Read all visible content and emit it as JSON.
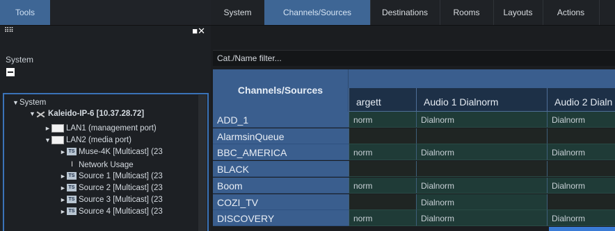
{
  "left": {
    "tools_tab": "Tools",
    "panel_title": "System",
    "tree": [
      {
        "label": "System",
        "arrow": "▼",
        "icon": "none",
        "bold": false
      },
      {
        "label": "Kaleido-IP-6 [10.37.28.72]",
        "arrow": "▼",
        "icon": "device-icon",
        "bold": true
      },
      {
        "label": "LAN1 (management port)",
        "arrow": "►",
        "icon": "port-icon",
        "bold": false
      },
      {
        "label": "LAN2 (media port)",
        "arrow": "▼",
        "icon": "port-icon",
        "bold": false
      },
      {
        "label": "Muse-4K [Multicast] (23",
        "arrow": "►",
        "icon": "ts-icon",
        "bold": false
      },
      {
        "label": "Network Usage",
        "arrow": "",
        "icon": "usage-icon",
        "bold": false
      },
      {
        "label": "Source 1 [Multicast] (23",
        "arrow": "►",
        "icon": "ts-icon",
        "bold": false
      },
      {
        "label": "Source 2 [Multicast] (23",
        "arrow": "►",
        "icon": "ts-icon",
        "bold": false
      },
      {
        "label": "Source 3 [Multicast] (23",
        "arrow": "►",
        "icon": "ts-icon",
        "bold": false
      },
      {
        "label": "Source 4 [Multicast] (23",
        "arrow": "►",
        "icon": "ts-icon",
        "bold": false
      }
    ]
  },
  "tabs": [
    "System",
    "Channels/Sources",
    "Destinations",
    "Rooms",
    "Layouts",
    "Actions"
  ],
  "active_tab": "Channels/Sources",
  "filter_placeholder": "Cat./Name filter...",
  "grid": {
    "row_header_title": "Channels/Sources",
    "columns": [
      "argett",
      "Audio 1 Dialnorm",
      "Audio 2 Dialn"
    ],
    "rows": [
      {
        "name": "ADD_1",
        "cells": [
          "norm",
          "Dialnorm",
          "Dialnorm"
        ]
      },
      {
        "name": "AlarmsinQueue",
        "cells": [
          "",
          "",
          ""
        ]
      },
      {
        "name": "BBC_AMERICA",
        "cells": [
          "norm",
          "Dialnorm",
          "Dialnorm"
        ]
      },
      {
        "name": "BLACK",
        "cells": [
          "",
          "",
          ""
        ]
      },
      {
        "name": "Boom",
        "cells": [
          "norm",
          "Dialnorm",
          "Dialnorm"
        ]
      },
      {
        "name": "COZI_TV",
        "cells": [
          "",
          "Dialnorm",
          ""
        ]
      },
      {
        "name": "DISCOVERY",
        "cells": [
          "norm",
          "Dialnorm",
          "Dialnorm"
        ]
      }
    ]
  },
  "colors": {
    "accent": "#3e6695",
    "row_label_bg": "#3a5e8e",
    "cell_bg": "#1f3b37",
    "panel_border": "#3a73b8"
  }
}
